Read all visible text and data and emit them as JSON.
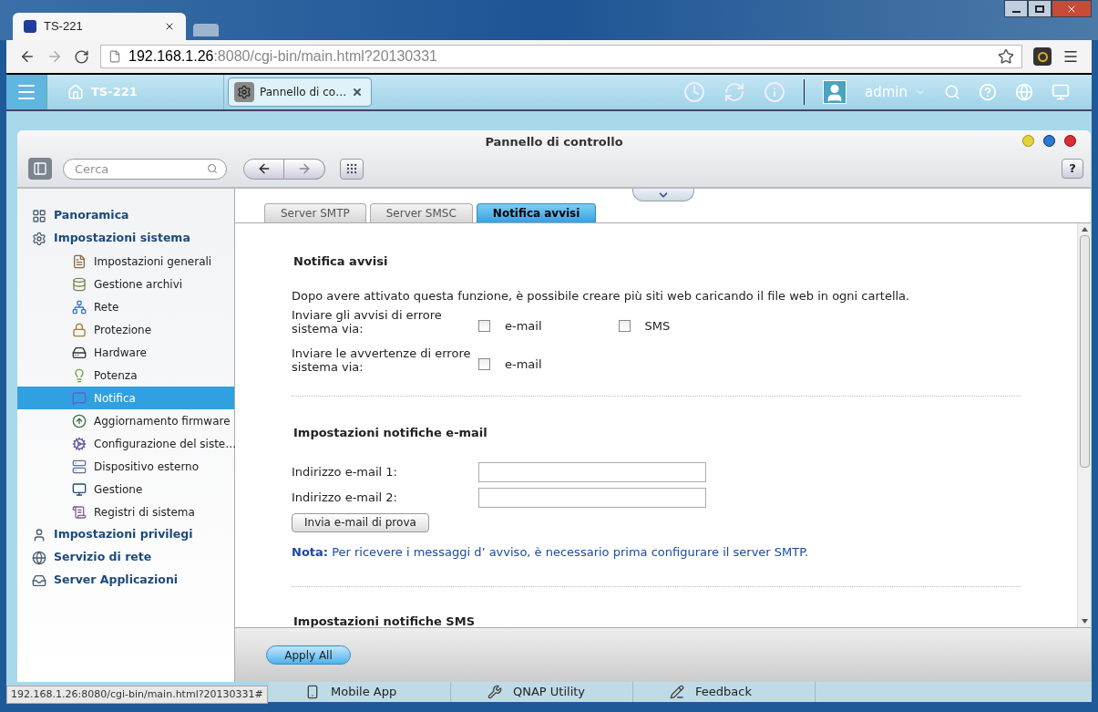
{
  "browser": {
    "tab_title": "TS-221",
    "url_host": "192.168.1.26",
    "url_rest": ":8080/cgi-bin/main.html?20130331"
  },
  "top_bar": {
    "home_label": "TS-221",
    "app_tab": "Pannello di co…",
    "user": "admin"
  },
  "window": {
    "title": "Pannello di controllo",
    "search": {
      "placeholder": "Cerca"
    },
    "help_button": "?"
  },
  "sidebar": {
    "items": [
      {
        "label": "Panoramica",
        "selected": false
      },
      {
        "label": "Impostazioni sistema",
        "selected": false,
        "children": [
          {
            "label": "Impostazioni generali",
            "selected": false
          },
          {
            "label": "Gestione archivi",
            "selected": false
          },
          {
            "label": "Rete",
            "selected": false
          },
          {
            "label": "Protezione",
            "selected": false
          },
          {
            "label": "Hardware",
            "selected": false
          },
          {
            "label": "Potenza",
            "selected": false
          },
          {
            "label": "Notifica",
            "selected": true
          },
          {
            "label": "Aggiornamento firmware",
            "selected": false
          },
          {
            "label": "Configurazione del siste…",
            "selected": false
          },
          {
            "label": "Dispositivo esterno",
            "selected": false
          },
          {
            "label": "Gestione",
            "selected": false
          },
          {
            "label": "Registri di sistema",
            "selected": false
          }
        ]
      },
      {
        "label": "Impostazioni privilegi",
        "selected": false
      },
      {
        "label": "Servizio di rete",
        "selected": false
      },
      {
        "label": "Server Applicazioni",
        "selected": false
      }
    ]
  },
  "tabs": [
    {
      "label": "Server SMTP",
      "selected": false
    },
    {
      "label": "Server SMSC",
      "selected": false
    },
    {
      "label": "Notifica avvisi",
      "selected": true
    }
  ],
  "alerts": {
    "title": "Notifica avvisi",
    "description": "Dopo avere attivato questa funzione, è possibile creare più siti web caricando il file web in ogni cartella.",
    "rows": [
      {
        "label": "Inviare gli avvisi di errore sistema via:",
        "options": [
          {
            "label": "e-mail",
            "checked": false
          },
          {
            "label": "SMS",
            "checked": false
          }
        ]
      },
      {
        "label": "Inviare le avvertenze di errore sistema via:",
        "options": [
          {
            "label": "e-mail",
            "checked": false
          }
        ]
      }
    ]
  },
  "email": {
    "title": "Impostazioni notifiche e-mail",
    "fields": [
      {
        "label": "Indirizzo e-mail 1:"
      },
      {
        "label": "Indirizzo e-mail 2:"
      }
    ],
    "test_button": "Invia e-mail di prova",
    "note": "**Nota:** Per ricevere i messaggi d’  avviso, è necessario prima configurare il server SMTP."
  },
  "sms": {
    "title": "Impostazioni notifiche SMS"
  },
  "apply_button": "Apply All",
  "dock": [
    {
      "label": "Mobile App"
    },
    {
      "label": "QNAP Utility"
    },
    {
      "label": "Feedback"
    }
  ],
  "status_bar": "192.168.1.26:8080/cgi-bin/main.html?20130331#"
}
